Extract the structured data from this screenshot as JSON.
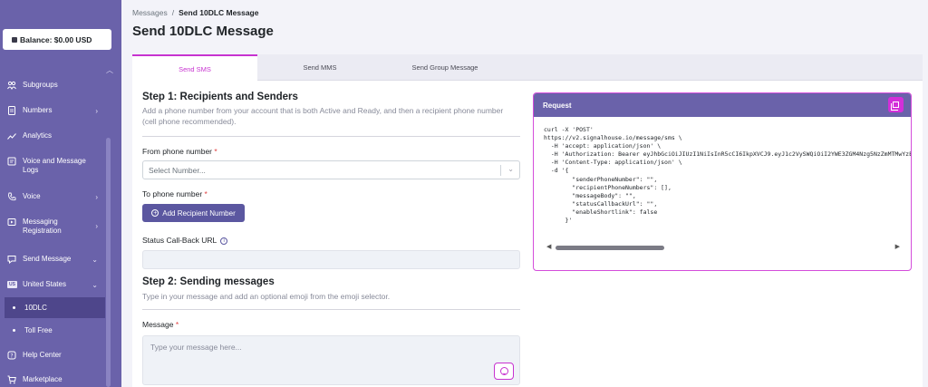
{
  "sidebar": {
    "balance": "Balance: $0.00 USD",
    "items": [
      {
        "label": "Subgroups",
        "icon": "subgroups-icon"
      },
      {
        "label": "Numbers",
        "icon": "numbers-icon"
      },
      {
        "label": "Analytics",
        "icon": "analytics-icon"
      },
      {
        "label": "Voice and Message Logs",
        "icon": "logs-icon"
      },
      {
        "label": "Voice",
        "icon": "phone-icon"
      },
      {
        "label": "Messaging Registration",
        "icon": "registration-icon"
      },
      {
        "label": "Send Message",
        "icon": "send-icon"
      },
      {
        "label": "United States",
        "flag": "US"
      },
      {
        "label": "10DLC"
      },
      {
        "label": "Toll Free"
      },
      {
        "label": "Help Center",
        "icon": "help-icon"
      },
      {
        "label": "Marketplace",
        "icon": "cart-icon"
      }
    ]
  },
  "breadcrumb": {
    "parent": "Messages",
    "separator": "/",
    "current": "Send 10DLC Message"
  },
  "page_title": "Send 10DLC Message",
  "tabs": [
    "Send SMS",
    "Send MMS",
    "Send Group Message"
  ],
  "step1": {
    "title": "Step 1: Recipients and Senders",
    "description": "Add a phone number from your account that is both Active and Ready, and then a recipient phone number (cell phone recommended).",
    "from_label": "From phone number",
    "required_mark": "*",
    "select_placeholder": "Select Number...",
    "to_label": "To phone number",
    "add_recipient": "Add Recipient Number",
    "callback_label": "Status Call-Back URL"
  },
  "step2": {
    "title": "Step 2: Sending messages",
    "description": "Type in your message and add an optional emoji from the emoji selector.",
    "message_label": "Message",
    "message_placeholder": "Type your message here..."
  },
  "request": {
    "title": "Request",
    "code": [
      "curl -X 'POST'",
      "https://v2.signalhouse.io/message/sms \\",
      "  -H 'accept: application/json' \\",
      "  -H 'Authorization: Bearer eyJhbGciOiJIUzI1NiIsInR5cCI6IkpXVCJ9.eyJ1c2VySWQiOiI2YWE3ZGM4Nzg5NzZmMTMwYzE",
      "  -H 'Content-Type: application/json' \\",
      "  -d '{",
      "        \"senderPhoneNumber\": \"\",",
      "        \"recipientPhoneNumbers\": [],",
      "        \"messageBody\": \"\",",
      "        \"statusCallbackUrl\": \"\",",
      "        \"enableShortlink\": false",
      "      }'"
    ]
  },
  "colors": {
    "sidebar": "#6a62aa",
    "accent": "#c733d0",
    "button": "#5b57a0"
  }
}
